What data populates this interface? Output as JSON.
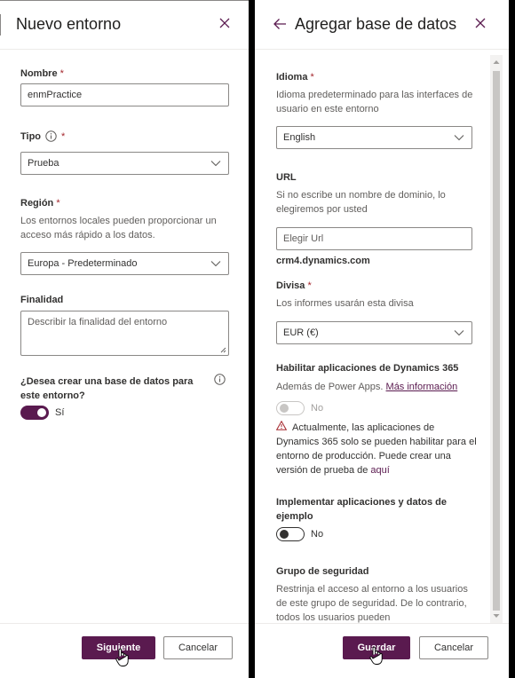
{
  "left_panel": {
    "title": "Nuevo entorno",
    "name_label": "Nombre",
    "name_value": "enmPractice",
    "type_label": "Tipo",
    "type_value": "Prueba",
    "region_label": "Región",
    "region_hint": "Los entornos locales pueden proporcionar un acceso más rápido a los datos.",
    "region_value": "Europa - Predeterminado",
    "purpose_label": "Finalidad",
    "purpose_placeholder": "Describir la finalidad del entorno",
    "db_question": "¿Desea crear una base de datos para este entorno?",
    "db_toggle_label": "Sí",
    "db_toggle_on": true,
    "next_button": "Siguiente",
    "cancel_button": "Cancelar"
  },
  "right_panel": {
    "title": "Agregar base de datos",
    "language_label": "Idioma",
    "language_hint": "Idioma predeterminado para las interfaces de usuario en este entorno",
    "language_value": "English",
    "url_label": "URL",
    "url_hint": "Si no escribe un nombre de dominio, lo elegiremos por usted",
    "url_placeholder": "Elegir Url",
    "url_suffix": "crm4.dynamics.com",
    "currency_label": "Divisa",
    "currency_hint": "Los informes usarán esta divisa",
    "currency_value": "EUR (€)",
    "d365_label": "Habilitar aplicaciones de Dynamics 365",
    "d365_hint": "Además de Power Apps.",
    "d365_link": "Más información",
    "d365_toggle_label": "No",
    "d365_toggle_on": false,
    "warning_text": "Actualmente, las aplicaciones de Dynamics 365 solo se pueden habilitar para el entorno de producción. Puede crear una versión de prueba de",
    "warning_link": "aquí",
    "sample_label": "Implementar aplicaciones y datos de ejemplo",
    "sample_toggle_label": "No",
    "sample_toggle_on": false,
    "security_label": "Grupo de seguridad",
    "security_hint": "Restrinja el acceso al entorno a los usuarios de este grupo de seguridad. De lo contrario, todos los usuarios pueden",
    "save_button": "Guardar",
    "cancel_button": "Cancelar"
  },
  "colors": {
    "accent": "#5a1a4f",
    "required": "#a4262c",
    "warning": "#a4262c",
    "border": "#8a8886"
  },
  "icons": [
    "close-icon",
    "back-arrow-icon",
    "info-icon",
    "chevron-down-icon",
    "warning-icon",
    "hand-cursor-icon"
  ]
}
